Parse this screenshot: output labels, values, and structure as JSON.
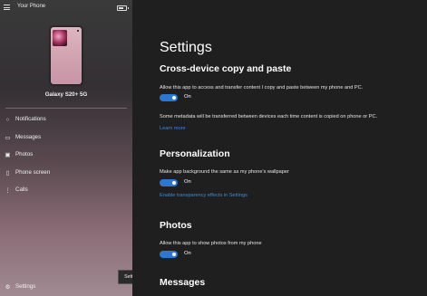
{
  "app": {
    "title": "Your Phone"
  },
  "device": {
    "name": "Galaxy S20+ 5G"
  },
  "sidebar": {
    "items": [
      {
        "label": "Notifications",
        "icon": "notifications-icon"
      },
      {
        "label": "Messages",
        "icon": "messages-icon"
      },
      {
        "label": "Photos",
        "icon": "photos-icon"
      },
      {
        "label": "Phone screen",
        "icon": "phone-screen-icon"
      },
      {
        "label": "Calls",
        "icon": "calls-icon"
      }
    ],
    "settings_label": "Settings",
    "tooltip": "Settings"
  },
  "main": {
    "title": "Settings",
    "sections": {
      "copy_paste": {
        "heading": "Cross-device copy and paste",
        "description": "Allow this app to access and transfer content I copy and paste between my phone and PC.",
        "toggle": "On",
        "note": "Some metadata will be transferred between devices each time content is copied on phone or PC.",
        "link": "Learn more"
      },
      "personalization": {
        "heading": "Personalization",
        "description": "Make app background the same as my phone's wallpaper",
        "toggle": "On",
        "link": "Enable transparency effects in Settings"
      },
      "photos": {
        "heading": "Photos",
        "description": "Allow this app to show photos from my phone",
        "toggle": "On"
      },
      "messages": {
        "heading": "Messages"
      }
    }
  },
  "colors": {
    "accent": "#2b78d4",
    "link": "#3d8bd6",
    "background": "#1f1f1f"
  }
}
